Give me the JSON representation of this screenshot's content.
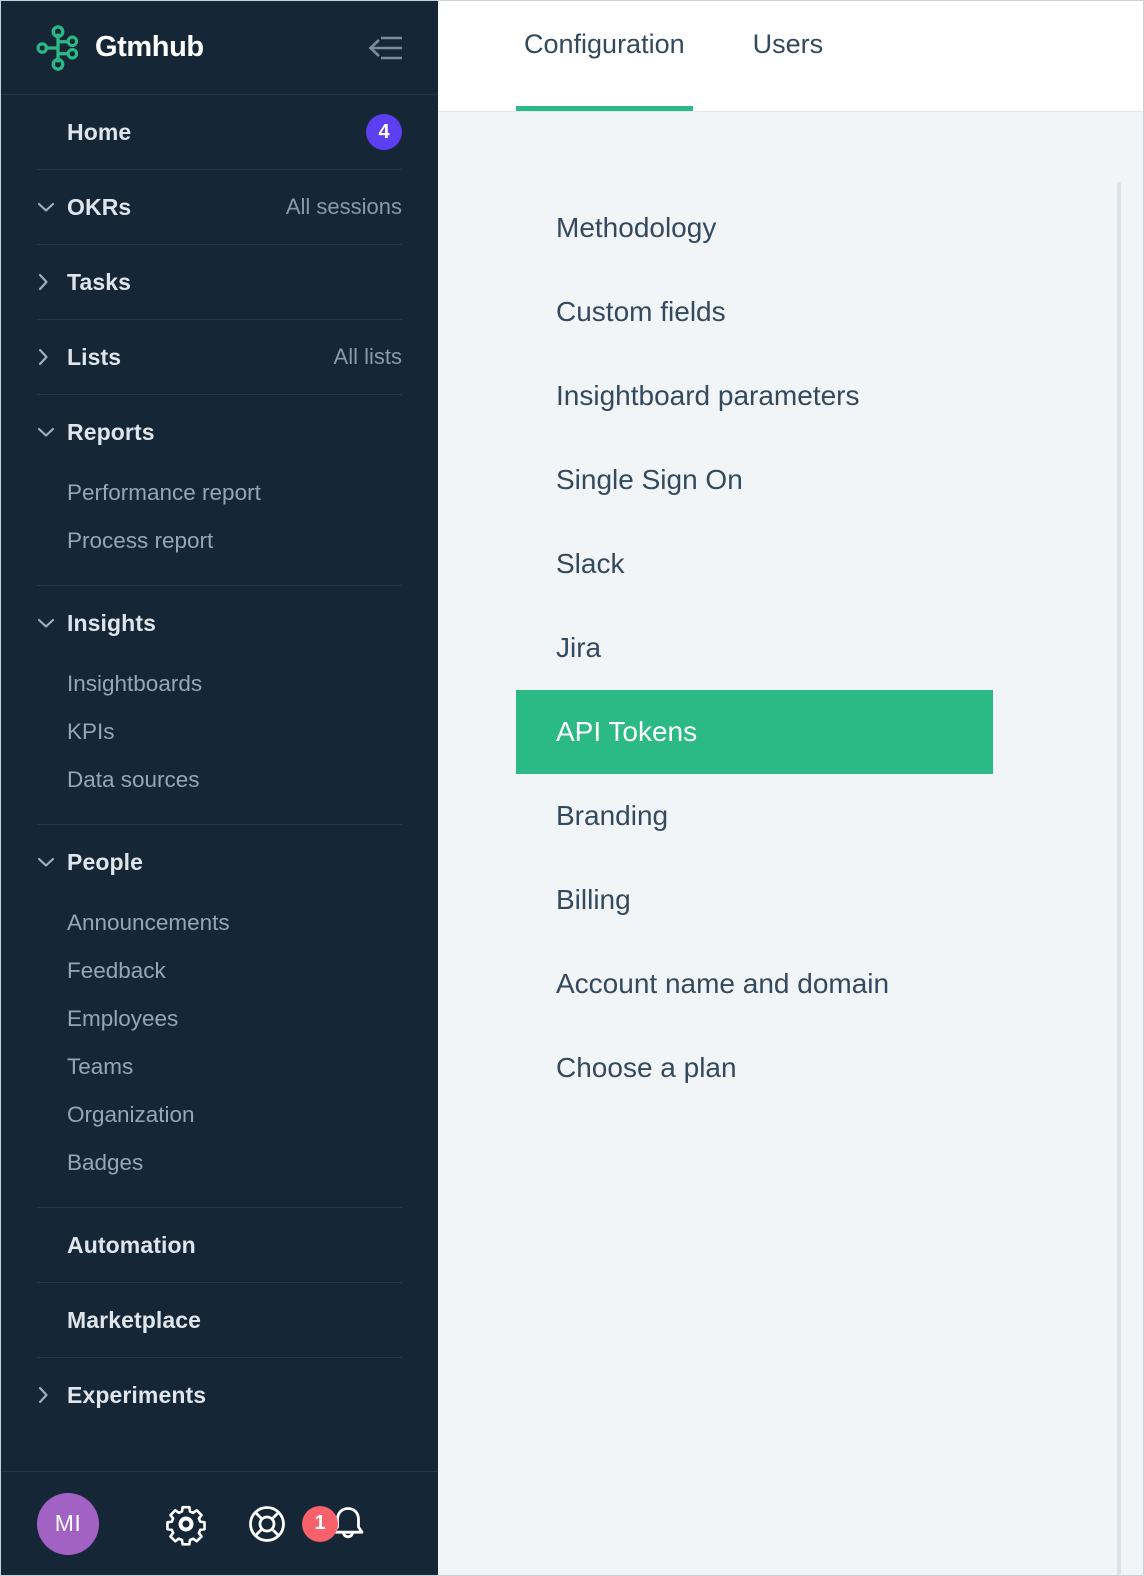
{
  "sidebar": {
    "brand": {
      "name": "Gtmhub",
      "logo_icon": "gtmhub-node-logo",
      "color": "#2bba86"
    },
    "collapse_icon": "collapse-sidebar-icon",
    "groups": [
      {
        "label": "Home",
        "caret": "none",
        "badge": "4",
        "badge_color": "#5c3ff0",
        "children": []
      },
      {
        "label": "OKRs",
        "caret": "down",
        "aside": "All sessions",
        "children": []
      },
      {
        "label": "Tasks",
        "caret": "right",
        "children": []
      },
      {
        "label": "Lists",
        "caret": "right",
        "aside": "All lists",
        "children": []
      },
      {
        "label": "Reports",
        "caret": "down",
        "children": [
          "Performance report",
          "Process report"
        ]
      },
      {
        "label": "Insights",
        "caret": "down",
        "children": [
          "Insightboards",
          "KPIs",
          "Data sources"
        ]
      },
      {
        "label": "People",
        "caret": "down",
        "children": [
          "Announcements",
          "Feedback",
          "Employees",
          "Teams",
          "Organization",
          "Badges"
        ]
      },
      {
        "label": "Automation",
        "caret": "none",
        "children": []
      },
      {
        "label": "Marketplace",
        "caret": "none",
        "children": []
      },
      {
        "label": "Experiments",
        "caret": "right",
        "children": []
      }
    ],
    "footer": {
      "avatar_initials": "MI",
      "avatar_color": "#a262c4",
      "settings_icon": "gear-icon",
      "help_icon": "life-ring-icon",
      "notifications_icon": "bell-icon",
      "notifications_count": "1",
      "notifications_badge_color": "#f9616a"
    }
  },
  "main": {
    "tabs": [
      {
        "label": "Configuration",
        "active": true
      },
      {
        "label": "Users",
        "active": false
      }
    ],
    "active_accent": "#2bba86",
    "configuration_items": [
      {
        "label": "Methodology",
        "selected": false
      },
      {
        "label": "Custom fields",
        "selected": false
      },
      {
        "label": "Insightboard parameters",
        "selected": false
      },
      {
        "label": "Single Sign On",
        "selected": false
      },
      {
        "label": "Slack",
        "selected": false
      },
      {
        "label": "Jira",
        "selected": false
      },
      {
        "label": "API Tokens",
        "selected": true
      },
      {
        "label": "Branding",
        "selected": false
      },
      {
        "label": "Billing",
        "selected": false
      },
      {
        "label": "Account name and domain",
        "selected": false
      },
      {
        "label": "Choose a plan",
        "selected": false
      }
    ]
  }
}
